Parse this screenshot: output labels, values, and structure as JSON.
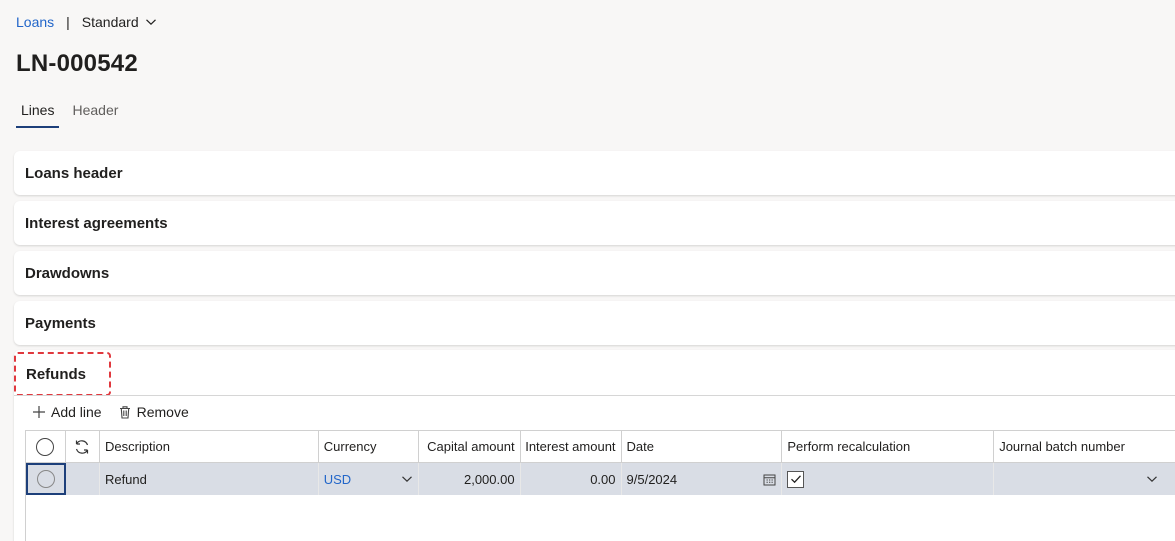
{
  "breadcrumb": {
    "module": "Loans",
    "separator": "|",
    "view": "Standard"
  },
  "page": {
    "title": "LN-000542"
  },
  "tabs": [
    {
      "label": "Lines",
      "active": true
    },
    {
      "label": "Header",
      "active": false
    }
  ],
  "sections": {
    "loans_header": "Loans header",
    "interest_agreements": "Interest agreements",
    "drawdowns": "Drawdowns",
    "payments": "Payments",
    "refunds": "Refunds"
  },
  "refunds": {
    "add_line_label": "Add line",
    "remove_label": "Remove",
    "columns": {
      "description": "Description",
      "currency": "Currency",
      "capital_amount": "Capital amount",
      "interest_amount": "Interest amount",
      "date": "Date",
      "perform_recalculation": "Perform recalculation",
      "journal_batch_number": "Journal batch number"
    },
    "rows": [
      {
        "description": "Refund",
        "currency": "USD",
        "capital_amount": "2,000.00",
        "interest_amount": "0.00",
        "date": "9/5/2024",
        "perform_recalculation": true,
        "journal_batch_number": ""
      }
    ]
  },
  "colors": {
    "accent": "#2266c9",
    "selection": "#1d3f7a",
    "highlight_border": "#e0383e",
    "selected_row": "#d9dde5"
  }
}
